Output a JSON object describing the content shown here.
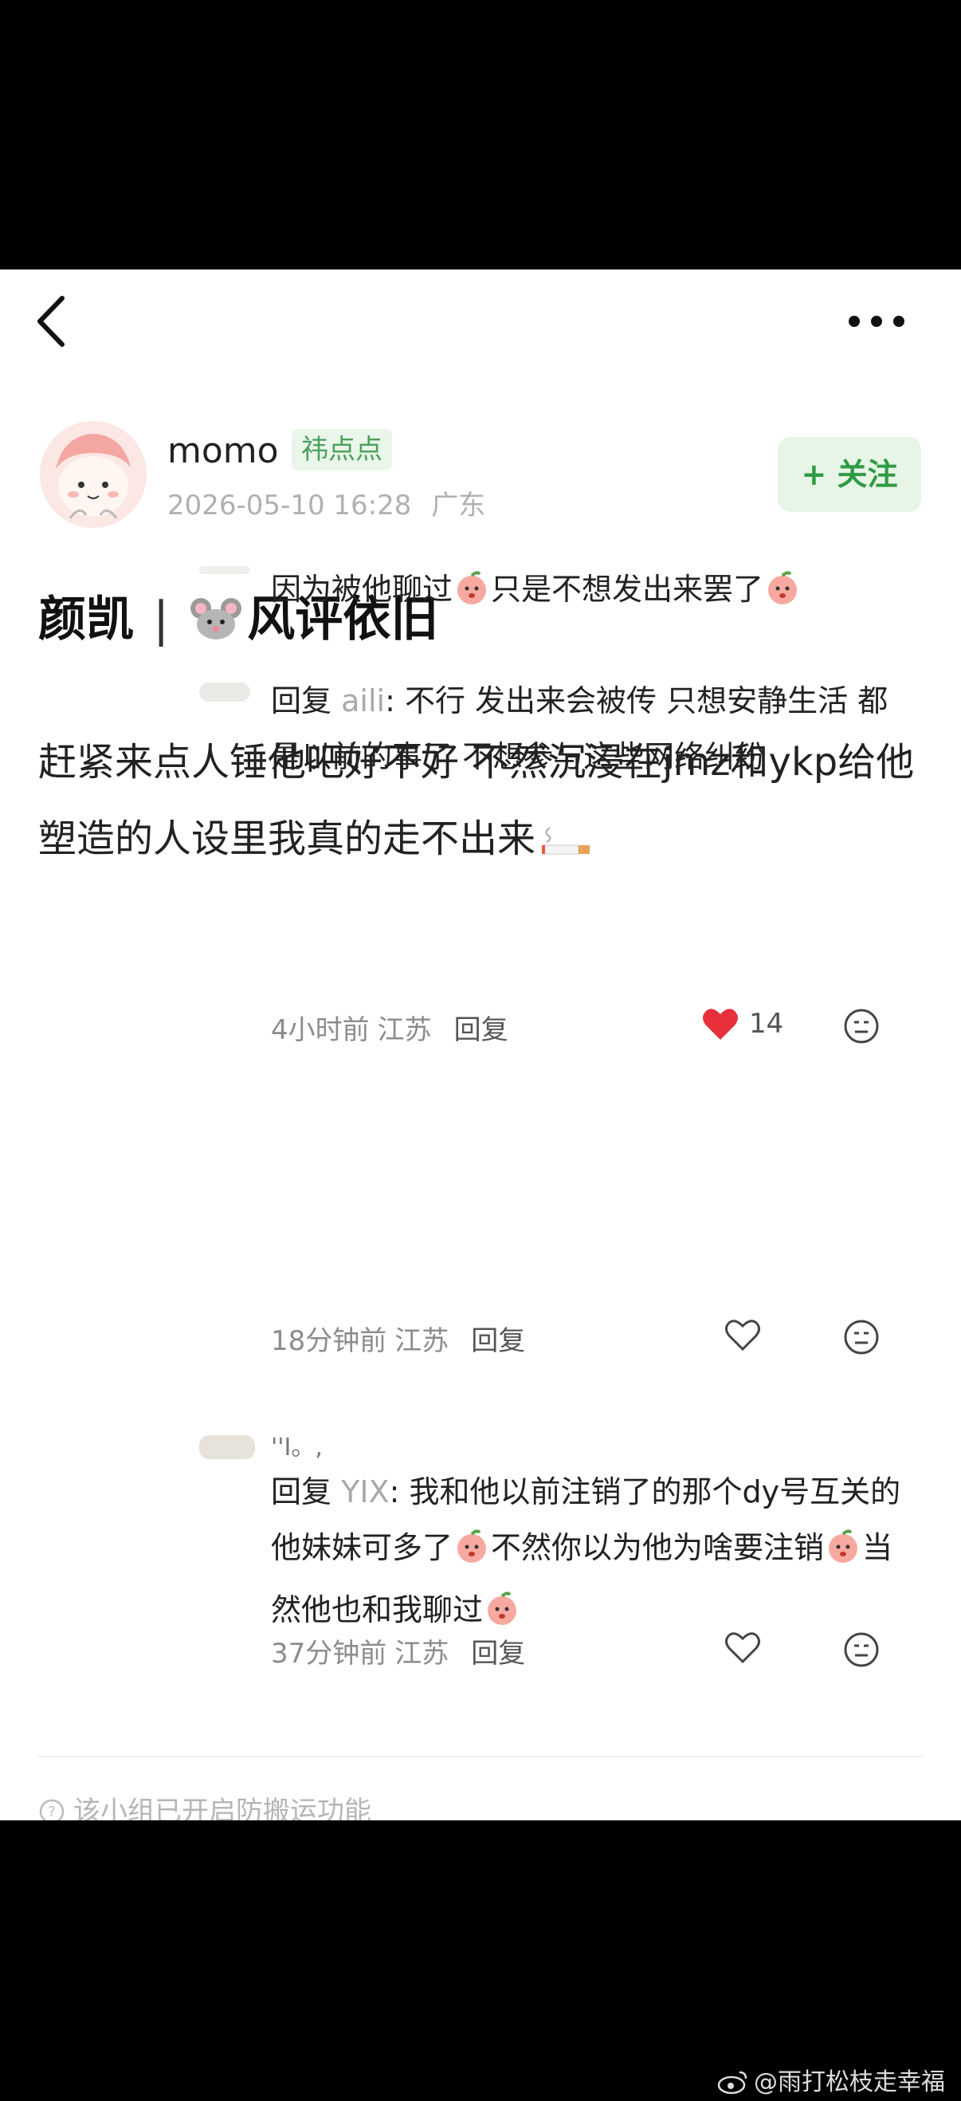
{
  "author": {
    "name": "momo",
    "tag": "祎点点",
    "timestamp": "2026-05-10 16:28",
    "location": "广东",
    "follow_label": "+ 关注"
  },
  "post": {
    "title_left": "颜凯",
    "title_sep": "|",
    "title_right": "风评依旧",
    "body": "赶紧来点人锤他吧好不好 不然沉浸在jmz和ykp给他塑造的人设里我真的走不出来"
  },
  "comments": [
    {
      "text_a": "因为被他聊过",
      "text_b": "只是不想发出来罢了",
      "time": "4小时前",
      "location": "江苏",
      "reply_label": "回复",
      "likes": "14",
      "liked": true
    },
    {
      "reply_prefix": "回复",
      "reply_to": "aili",
      "text": "不行 发出来会被传 只想安静生活 都是以前的事了 不想参与这些网络纠纷",
      "time": "18分钟前",
      "location": "江苏",
      "reply_label": "回复",
      "liked": false
    },
    {
      "nickname_fragment": "''I。,",
      "reply_prefix": "回复",
      "reply_to": "YIX",
      "text_a": "我和他以前注销了的那个dy号互关的 他妹妹可多了",
      "text_b": "不然你以为他为啥要注销",
      "text_c": "当然他也和我聊过",
      "time": "37分钟前",
      "location": "江苏",
      "reply_label": "回复",
      "liked": false
    }
  ],
  "notice": "该小组已开启防搬运功能",
  "watermark": "@雨打松枝走幸福",
  "colors": {
    "accent_green": "#2f9a45",
    "heart_red": "#e8303a",
    "tag_green": "#4aa05a"
  },
  "icons": [
    "back-arrow-icon",
    "more-dots-icon",
    "mouse-emoji-icon",
    "cigarette-emoji-icon",
    "peach-emoji-icon",
    "heart-icon",
    "emoji-face-icon",
    "help-circle-icon",
    "weibo-icon"
  ]
}
